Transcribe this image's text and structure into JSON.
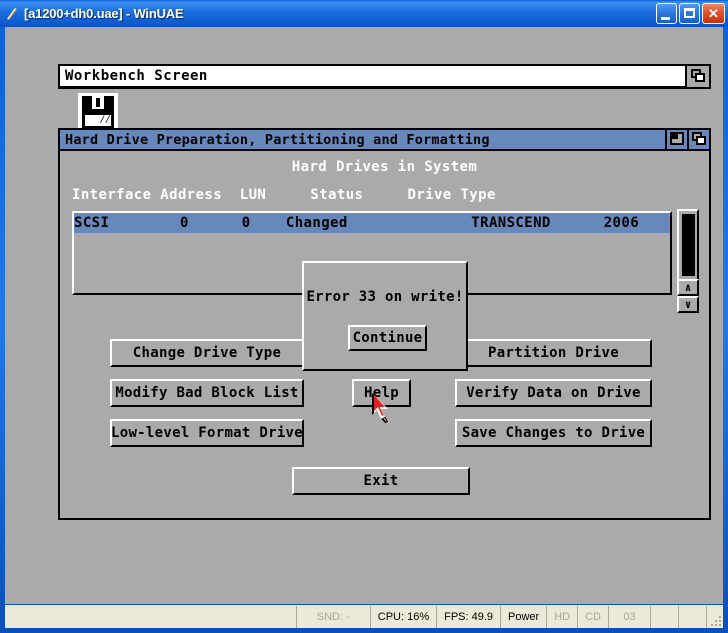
{
  "window": {
    "title": "[a1200+dh0.uae] - WinUAE",
    "icon": "winuae-icon",
    "controls": {
      "minimize": "minimize-button",
      "maximize": "maximize-button",
      "close": "close-button"
    }
  },
  "screen": {
    "title": "Workbench Screen",
    "depth_gadget": "depth-gadget",
    "icons": [
      {
        "name": "floppy-disk-icon"
      }
    ]
  },
  "hdtoolbox": {
    "title": "Hard Drive Preparation, Partitioning and Formatting",
    "zoom_gadget": "zoom-gadget",
    "depth_gadget": "depth-gadget",
    "heading": "Hard Drives in System",
    "columns_line": "Interface Address  LUN     Status     Drive Type",
    "columns": [
      "Interface",
      "Address",
      "LUN",
      "Status",
      "Drive Type"
    ],
    "rows": [
      {
        "line": "SCSI        0      0    Changed              TRANSCEND      2006",
        "interface": "SCSI",
        "address": "0",
        "lun": "0",
        "status": "Changed",
        "drive_type": "TRANSCEND",
        "drive_rev": "2006",
        "selected": true
      }
    ],
    "scrollbar": {
      "up_arrow": "∧",
      "down_arrow": "∨"
    },
    "buttons": {
      "change_drive_type": "Change Drive Type",
      "partition_drive": "Partition Drive",
      "modify_bad_block_list": "Modify Bad Block List",
      "help": "Help",
      "verify_data_on_drive": "Verify Data on Drive",
      "low_level_format_drive": "Low-level Format Drive",
      "save_changes_to_drive": "Save Changes to Drive",
      "exit": "Exit"
    }
  },
  "requester": {
    "message": "Error 33 on write!",
    "continue_label": "Continue"
  },
  "statusbar": {
    "sound": "SND: -",
    "cpu": "CPU: 16%",
    "fps": "FPS: 49.9",
    "power": "Power",
    "hd": "HD",
    "cd": "CD",
    "drive": "03"
  },
  "colors": {
    "amiga_gray": "#aaaaaa",
    "amiga_blue": "#6688bb",
    "amiga_black": "#000000",
    "amiga_white": "#ffffff",
    "xp_titlebar": "#1f7ae8",
    "xp_statusbar": "#ece9d8"
  }
}
